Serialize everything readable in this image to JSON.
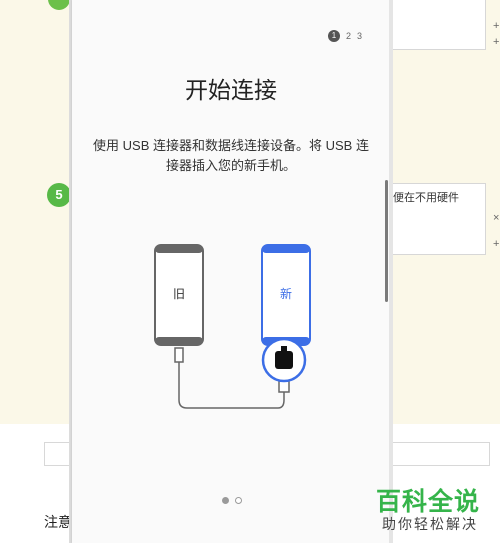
{
  "status_bar": {
    "left_ghost": " ",
    "right_ghost": " "
  },
  "page_indicator": {
    "pages": [
      "1",
      "2",
      "3"
    ],
    "active": "1"
  },
  "title": "开始连接",
  "description": "使用 USB 连接器和数据线连接设备。将 USB 连接器插入您的新手机。",
  "diagram": {
    "old_label": "旧",
    "new_label": "新",
    "new_color": "#3c6ee6"
  },
  "background": {
    "step_number": "5",
    "right_note": "便在不用硬件",
    "note_label": "注意",
    "side_controls": [
      "+",
      "×",
      "+"
    ]
  },
  "watermark": {
    "title": "百科全说",
    "subtitle": "助你轻松解决",
    "color": "#35b44a"
  },
  "carousel_dots": {
    "count": 2,
    "active": 0
  }
}
